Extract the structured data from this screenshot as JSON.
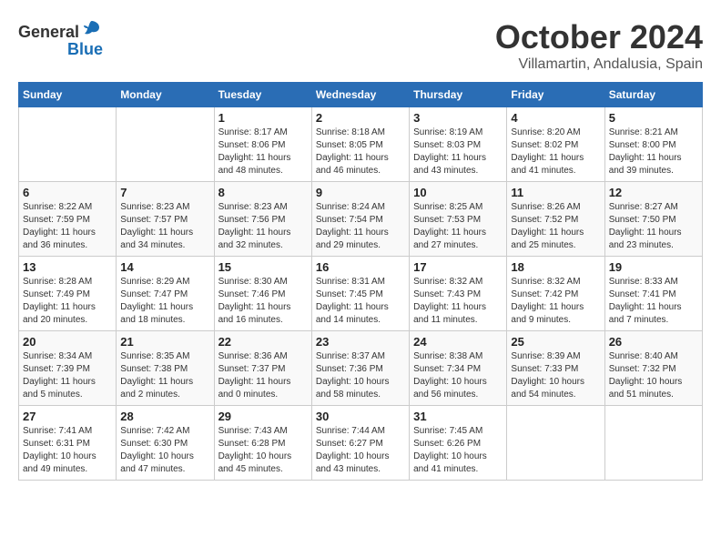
{
  "logo": {
    "general": "General",
    "blue": "Blue"
  },
  "title": "October 2024",
  "location": "Villamartin, Andalusia, Spain",
  "days_header": [
    "Sunday",
    "Monday",
    "Tuesday",
    "Wednesday",
    "Thursday",
    "Friday",
    "Saturday"
  ],
  "weeks": [
    [
      {
        "day": "",
        "info": ""
      },
      {
        "day": "",
        "info": ""
      },
      {
        "day": "1",
        "info": "Sunrise: 8:17 AM\nSunset: 8:06 PM\nDaylight: 11 hours and 48 minutes."
      },
      {
        "day": "2",
        "info": "Sunrise: 8:18 AM\nSunset: 8:05 PM\nDaylight: 11 hours and 46 minutes."
      },
      {
        "day": "3",
        "info": "Sunrise: 8:19 AM\nSunset: 8:03 PM\nDaylight: 11 hours and 43 minutes."
      },
      {
        "day": "4",
        "info": "Sunrise: 8:20 AM\nSunset: 8:02 PM\nDaylight: 11 hours and 41 minutes."
      },
      {
        "day": "5",
        "info": "Sunrise: 8:21 AM\nSunset: 8:00 PM\nDaylight: 11 hours and 39 minutes."
      }
    ],
    [
      {
        "day": "6",
        "info": "Sunrise: 8:22 AM\nSunset: 7:59 PM\nDaylight: 11 hours and 36 minutes."
      },
      {
        "day": "7",
        "info": "Sunrise: 8:23 AM\nSunset: 7:57 PM\nDaylight: 11 hours and 34 minutes."
      },
      {
        "day": "8",
        "info": "Sunrise: 8:23 AM\nSunset: 7:56 PM\nDaylight: 11 hours and 32 minutes."
      },
      {
        "day": "9",
        "info": "Sunrise: 8:24 AM\nSunset: 7:54 PM\nDaylight: 11 hours and 29 minutes."
      },
      {
        "day": "10",
        "info": "Sunrise: 8:25 AM\nSunset: 7:53 PM\nDaylight: 11 hours and 27 minutes."
      },
      {
        "day": "11",
        "info": "Sunrise: 8:26 AM\nSunset: 7:52 PM\nDaylight: 11 hours and 25 minutes."
      },
      {
        "day": "12",
        "info": "Sunrise: 8:27 AM\nSunset: 7:50 PM\nDaylight: 11 hours and 23 minutes."
      }
    ],
    [
      {
        "day": "13",
        "info": "Sunrise: 8:28 AM\nSunset: 7:49 PM\nDaylight: 11 hours and 20 minutes."
      },
      {
        "day": "14",
        "info": "Sunrise: 8:29 AM\nSunset: 7:47 PM\nDaylight: 11 hours and 18 minutes."
      },
      {
        "day": "15",
        "info": "Sunrise: 8:30 AM\nSunset: 7:46 PM\nDaylight: 11 hours and 16 minutes."
      },
      {
        "day": "16",
        "info": "Sunrise: 8:31 AM\nSunset: 7:45 PM\nDaylight: 11 hours and 14 minutes."
      },
      {
        "day": "17",
        "info": "Sunrise: 8:32 AM\nSunset: 7:43 PM\nDaylight: 11 hours and 11 minutes."
      },
      {
        "day": "18",
        "info": "Sunrise: 8:32 AM\nSunset: 7:42 PM\nDaylight: 11 hours and 9 minutes."
      },
      {
        "day": "19",
        "info": "Sunrise: 8:33 AM\nSunset: 7:41 PM\nDaylight: 11 hours and 7 minutes."
      }
    ],
    [
      {
        "day": "20",
        "info": "Sunrise: 8:34 AM\nSunset: 7:39 PM\nDaylight: 11 hours and 5 minutes."
      },
      {
        "day": "21",
        "info": "Sunrise: 8:35 AM\nSunset: 7:38 PM\nDaylight: 11 hours and 2 minutes."
      },
      {
        "day": "22",
        "info": "Sunrise: 8:36 AM\nSunset: 7:37 PM\nDaylight: 11 hours and 0 minutes."
      },
      {
        "day": "23",
        "info": "Sunrise: 8:37 AM\nSunset: 7:36 PM\nDaylight: 10 hours and 58 minutes."
      },
      {
        "day": "24",
        "info": "Sunrise: 8:38 AM\nSunset: 7:34 PM\nDaylight: 10 hours and 56 minutes."
      },
      {
        "day": "25",
        "info": "Sunrise: 8:39 AM\nSunset: 7:33 PM\nDaylight: 10 hours and 54 minutes."
      },
      {
        "day": "26",
        "info": "Sunrise: 8:40 AM\nSunset: 7:32 PM\nDaylight: 10 hours and 51 minutes."
      }
    ],
    [
      {
        "day": "27",
        "info": "Sunrise: 7:41 AM\nSunset: 6:31 PM\nDaylight: 10 hours and 49 minutes."
      },
      {
        "day": "28",
        "info": "Sunrise: 7:42 AM\nSunset: 6:30 PM\nDaylight: 10 hours and 47 minutes."
      },
      {
        "day": "29",
        "info": "Sunrise: 7:43 AM\nSunset: 6:28 PM\nDaylight: 10 hours and 45 minutes."
      },
      {
        "day": "30",
        "info": "Sunrise: 7:44 AM\nSunset: 6:27 PM\nDaylight: 10 hours and 43 minutes."
      },
      {
        "day": "31",
        "info": "Sunrise: 7:45 AM\nSunset: 6:26 PM\nDaylight: 10 hours and 41 minutes."
      },
      {
        "day": "",
        "info": ""
      },
      {
        "day": "",
        "info": ""
      }
    ]
  ]
}
